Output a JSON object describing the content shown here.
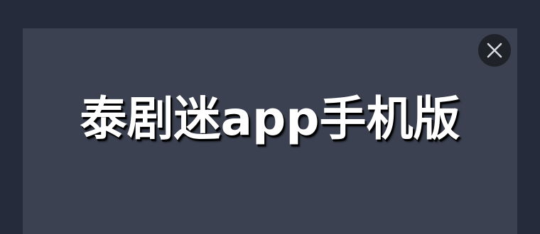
{
  "banner": {
    "title": "泰剧迷app手机版"
  },
  "close_button": {
    "icon": "close-icon"
  },
  "colors": {
    "page_background": "#252b3a",
    "banner_background": "#3b4150",
    "title_text": "#ffffff",
    "close_button_background": "#1f2229"
  }
}
